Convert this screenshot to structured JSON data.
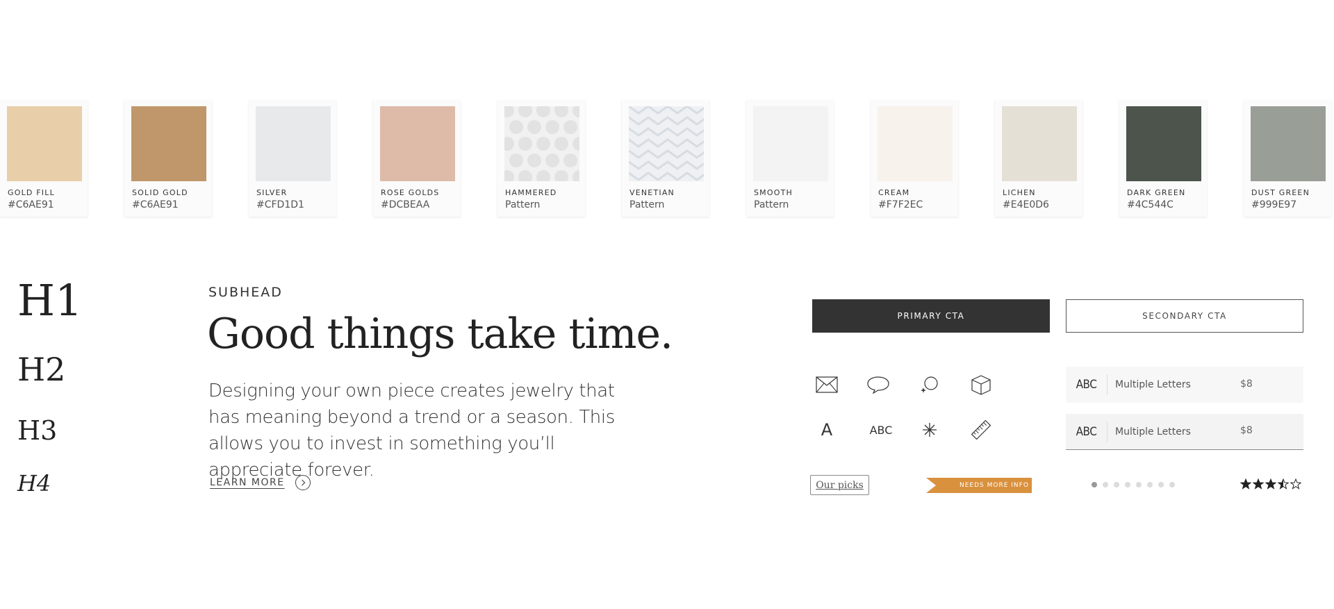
{
  "swatches": [
    {
      "name": "GOLD FILL",
      "value": "#C6AE91",
      "fill": "#E8CFAA",
      "pattern": "solid"
    },
    {
      "name": "SOLID GOLD",
      "value": "#C6AE91",
      "fill": "#C0976A",
      "pattern": "solid"
    },
    {
      "name": "SILVER",
      "value": "#CFD1D1",
      "fill": "#E8E9EA",
      "pattern": "solid"
    },
    {
      "name": "ROSE GOLDS",
      "value": "#DCBEAA",
      "fill": "#DDBBA8",
      "pattern": "solid"
    },
    {
      "name": "HAMMERED",
      "value": "Pattern",
      "fill": "#F1F1F1",
      "pattern": "hammered"
    },
    {
      "name": "VENETIAN",
      "value": "Pattern",
      "fill": "#EEF0F3",
      "pattern": "venetian"
    },
    {
      "name": "SMOOTH",
      "value": "Pattern",
      "fill": "#F3F3F3",
      "pattern": "solid"
    },
    {
      "name": "CREAM",
      "value": "#F7F2EC",
      "fill": "#F7F2EC",
      "pattern": "solid"
    },
    {
      "name": "LICHEN",
      "value": "#E4E0D6",
      "fill": "#E4E0D6",
      "pattern": "solid"
    },
    {
      "name": "DARK GREEN",
      "value": "#4C544C",
      "fill": "#4C544C",
      "pattern": "solid"
    },
    {
      "name": "DUST GREEN",
      "value": "#999E97",
      "fill": "#999E97",
      "pattern": "solid"
    }
  ],
  "type_scale": {
    "h1": "H1",
    "h2": "H2",
    "h3": "H3",
    "h4": "H4"
  },
  "copy": {
    "subhead": "SUBHEAD",
    "headline": "Good things take time.",
    "body": "Designing your own piece creates jewelry that has meaning beyond a trend or a season. This allows you to invest in something you’ll appreciate forever.",
    "learn_more": "LEARN MORE"
  },
  "buttons": {
    "primary": "PRIMARY CTA",
    "secondary": "SECONDARY CTA"
  },
  "icons": [
    {
      "name": "envelope-icon",
      "kind": "svg"
    },
    {
      "name": "speech-bubble-icon",
      "kind": "svg"
    },
    {
      "name": "sparkle-chat-icon",
      "kind": "svg"
    },
    {
      "name": "box-icon",
      "kind": "svg"
    },
    {
      "name": "letter-a-icon",
      "kind": "text",
      "text": "A"
    },
    {
      "name": "abc-icon",
      "kind": "text",
      "text": "ABC"
    },
    {
      "name": "asterisk-icon",
      "kind": "svg"
    },
    {
      "name": "ruler-icon",
      "kind": "svg"
    }
  ],
  "options": [
    {
      "abbr": "ABC",
      "label": "Multiple Letters",
      "price": "$8",
      "selected": false
    },
    {
      "abbr": "ABC",
      "label": "Multiple Letters",
      "price": "$8",
      "selected": true
    }
  ],
  "tag": {
    "label": "Our picks"
  },
  "ribbon": {
    "label": "NEEDS MORE INFO",
    "color": "#D9913E"
  },
  "pager": {
    "count": 8,
    "active": 1
  },
  "rating": {
    "value": 3.5,
    "max": 5
  },
  "colors": {
    "primary_cta": "#333333",
    "text": "#222222"
  }
}
